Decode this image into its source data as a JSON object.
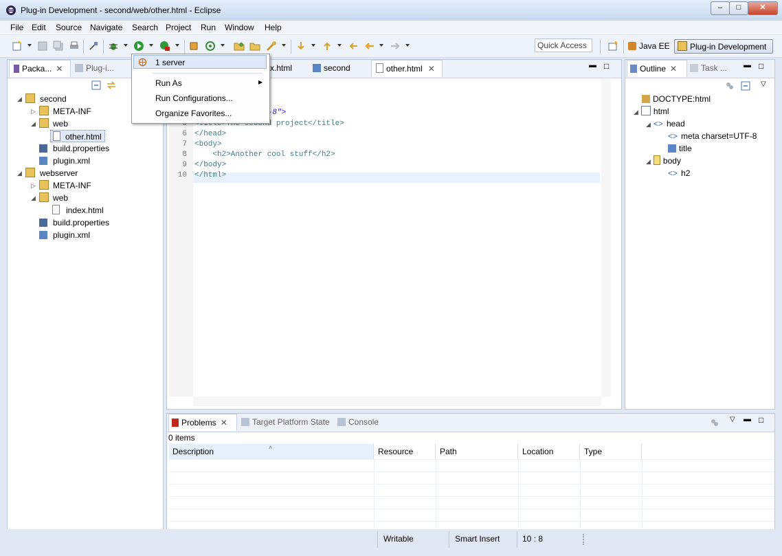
{
  "window": {
    "title": "Plug-in Development - second/web/other.html - Eclipse"
  },
  "menubar": [
    "File",
    "Edit",
    "Source",
    "Navigate",
    "Search",
    "Project",
    "Run",
    "Window",
    "Help"
  ],
  "quick_access": {
    "placeholder": "Quick Access"
  },
  "perspectives": {
    "java_ee": "Java EE",
    "plugin_dev": "Plug-in Development"
  },
  "left_panel": {
    "tabs": [
      "Packa...",
      "Plug-i..."
    ],
    "tree": [
      {
        "label": "second",
        "level": 0,
        "expanded": true
      },
      {
        "label": "META-INF",
        "level": 1,
        "expanded": false
      },
      {
        "label": "web",
        "level": 1,
        "expanded": true
      },
      {
        "label": "other.html",
        "level": 2,
        "selected": true
      },
      {
        "label": "build.properties",
        "level": 1
      },
      {
        "label": "plugin.xml",
        "level": 1
      },
      {
        "label": "webserver",
        "level": 0,
        "expanded": true
      },
      {
        "label": "META-INF",
        "level": 1,
        "expanded": false
      },
      {
        "label": "web",
        "level": 1,
        "expanded": true
      },
      {
        "label": "index.html",
        "level": 2
      },
      {
        "label": "build.properties",
        "level": 1
      },
      {
        "label": "plugin.xml",
        "level": 1
      }
    ]
  },
  "editor": {
    "tabs": [
      "x.html",
      "second",
      "other.html"
    ],
    "lines": [
      {
        "n": "",
        "text": "",
        "frag": "UTF-8\">"
      },
      {
        "n": "5",
        "text": "<title>The second project</title>"
      },
      {
        "n": "6",
        "text": "</head>"
      },
      {
        "n": "7",
        "text": "<body>"
      },
      {
        "n": "8",
        "text": "    <h2>Another cool stuff</h2>"
      },
      {
        "n": "9",
        "text": "</body>"
      },
      {
        "n": "10",
        "text": "</html>"
      }
    ]
  },
  "dropdown": {
    "items": [
      "1 server",
      "Run As",
      "Run Configurations...",
      "Organize Favorites..."
    ]
  },
  "outline": {
    "tabs": [
      "Outline",
      "Task ..."
    ],
    "tree": [
      {
        "label": "DOCTYPE:html"
      },
      {
        "label": "html"
      },
      {
        "label": "head"
      },
      {
        "label": "meta charset=UTF-8"
      },
      {
        "label": "title"
      },
      {
        "label": "body"
      },
      {
        "label": "h2"
      }
    ]
  },
  "bottom": {
    "tabs": [
      "Problems",
      "Target Platform State",
      "Console"
    ],
    "items_count": "0 items",
    "columns": [
      "Description",
      "Resource",
      "Path",
      "Location",
      "Type"
    ]
  },
  "status": {
    "writable": "Writable",
    "insert": "Smart Insert",
    "position": "10 : 8"
  }
}
